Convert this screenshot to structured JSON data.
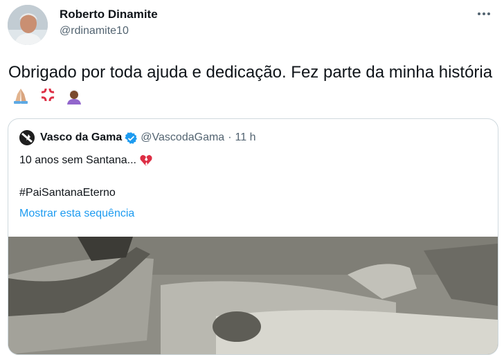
{
  "author": {
    "name": "Roberto Dinamite",
    "handle": "@rdinamite10"
  },
  "tweet": {
    "text": "Obrigado por toda ajuda e dedicação. Fez parte da minha história",
    "emojis": [
      "folded-hands-icon",
      "anger-icon",
      "person-with-turban-icon"
    ]
  },
  "quoted": {
    "name": "Vasco da Gama",
    "handle": "@VascodaGama",
    "separator": "·",
    "time": "11 h",
    "line1": "10 anos sem Santana...",
    "line1_emoji": "broken-heart-icon",
    "line2": "#PaiSantanaEterno",
    "show_thread": "Mostrar esta sequência"
  },
  "colors": {
    "text": "#0f1419",
    "secondary": "#536471",
    "link": "#1d9bf0",
    "border": "#cfd9de",
    "verified": "#1d9bf0"
  }
}
